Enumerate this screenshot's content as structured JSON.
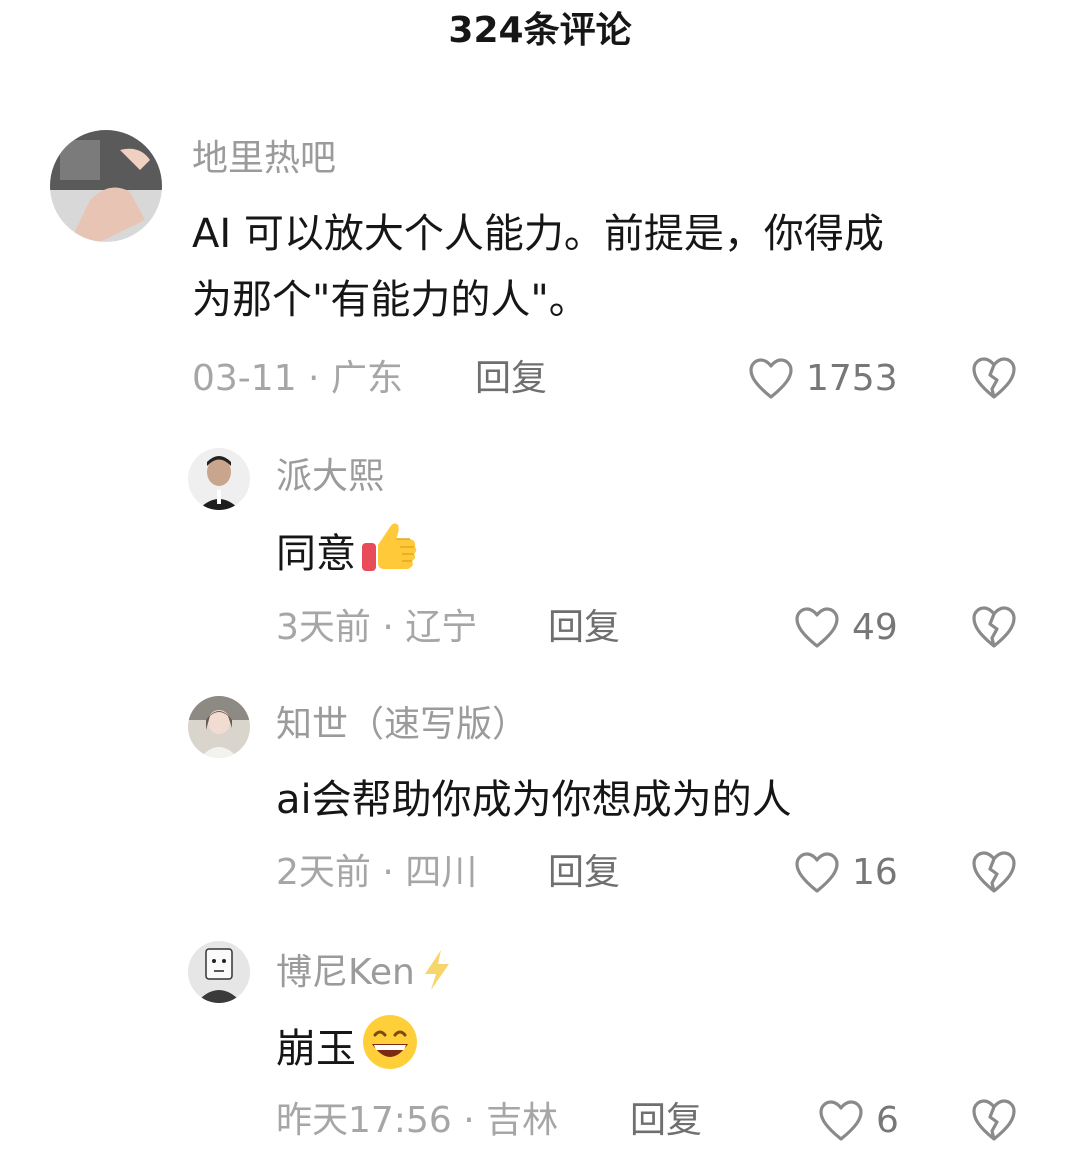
{
  "header": {
    "title": "324条评论"
  },
  "comments": [
    {
      "username": "地里热吧",
      "text_line1": "AI 可以放大个人能力。前提是，你得成",
      "text_line2": "为那个\"有能力的人\"。",
      "meta": "03-11 · 广东",
      "reply_label": "回复",
      "likes": "1753"
    },
    {
      "username": "派大熙",
      "text": "同意",
      "emoji": "thumbs-up-emoji",
      "meta": "3天前 · 辽宁",
      "reply_label": "回复",
      "likes": "49"
    },
    {
      "username": "知世（速写版）",
      "text": "ai会帮助你成为你想成为的人",
      "meta": "2天前 · 四川",
      "reply_label": "回复",
      "likes": "16"
    },
    {
      "username": "博尼Ken",
      "username_badge": "lightning-icon",
      "text": "崩玉",
      "emoji": "grinning-face-emoji",
      "meta": "昨天17:56 · 吉林",
      "reply_label": "回复",
      "likes": "6"
    }
  ],
  "colors": {
    "text": "#161616",
    "username": "#9b9b9b",
    "meta": "#a6a6a6",
    "icon": "#8a8a8a"
  }
}
